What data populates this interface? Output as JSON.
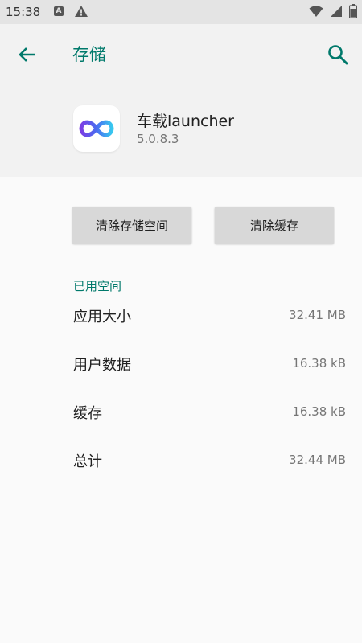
{
  "status_bar": {
    "time": "15:38",
    "notification_letter": "A"
  },
  "header": {
    "title": "存储"
  },
  "app": {
    "name": "车载launcher",
    "version": "5.0.8.3"
  },
  "buttons": {
    "clear_storage": "清除存储空间",
    "clear_cache": "清除缓存"
  },
  "storage": {
    "section_title": "已用空间",
    "rows": [
      {
        "label": "应用大小",
        "value": "32.41 MB"
      },
      {
        "label": "用户数据",
        "value": "16.38 kB"
      },
      {
        "label": "缓存",
        "value": "16.38 kB"
      },
      {
        "label": "总计",
        "value": "32.44 MB"
      }
    ]
  },
  "colors": {
    "accent": "#00796b",
    "header_bg": "#f2f2f2",
    "page_bg": "#fafafa",
    "button_bg": "#d8d8d8"
  },
  "icons": [
    "back-arrow-icon",
    "search-icon",
    "app-infinity-icon",
    "wifi-icon",
    "signal-icon",
    "battery-icon",
    "warning-icon"
  ]
}
